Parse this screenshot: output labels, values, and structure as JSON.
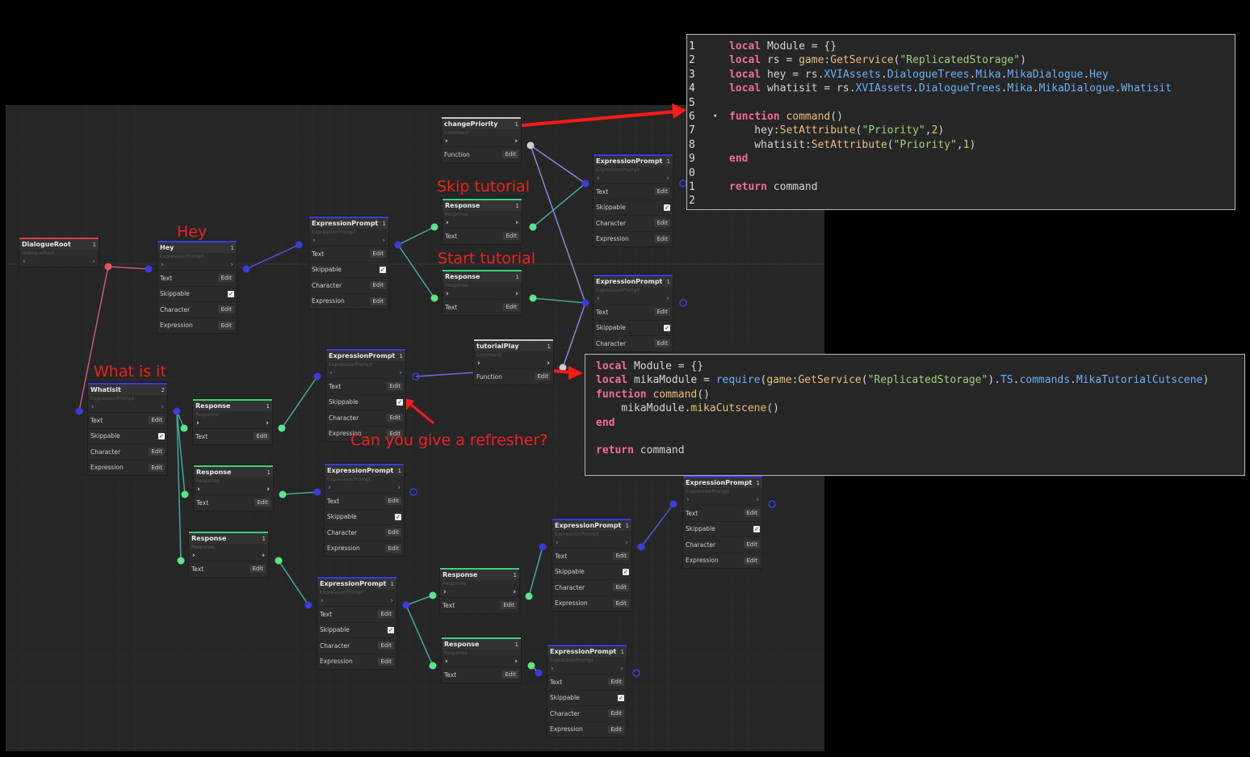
{
  "annotations": {
    "hey": "Hey",
    "what_is_it": "What is it",
    "skip_tutorial": "Skip tutorial",
    "start_tutorial": "Start tutorial",
    "refresher": "Can you give a refresher?"
  },
  "labels": {
    "edit": "Edit",
    "text": "Text",
    "skippable": "Skippable",
    "character": "Character",
    "expression": "Expression",
    "function": "Function",
    "expression_prompt": "ExpressionPrompt",
    "response": "Response",
    "command": "Command",
    "check": "✓",
    "count1": "1",
    "count2": "2"
  },
  "nodes": {
    "root": {
      "title": "DialogueRoot",
      "sub": "DialogueRoot",
      "count": "1"
    },
    "hey": {
      "title": "Hey",
      "sub": "ExpressionPrompt",
      "count": "1"
    },
    "whatisit": {
      "title": "Whatisit",
      "sub": "ExpressionPrompt",
      "count": "2"
    },
    "change_priority": {
      "title": "changePriority",
      "sub": "Command",
      "count": "1"
    },
    "tutorial_play": {
      "title": "tutorialPlay",
      "sub": "Command",
      "count": "1"
    }
  },
  "code1": {
    "lines": [
      {
        "n": "1",
        "parts": [
          [
            "kw",
            "local"
          ],
          [
            "ident",
            " Module = {}"
          ]
        ]
      },
      {
        "n": "2",
        "parts": [
          [
            "kw",
            "local"
          ],
          [
            "ident",
            " rs = "
          ],
          [
            "fn",
            "game"
          ],
          [
            "ident",
            ":"
          ],
          [
            "fn",
            "GetService"
          ],
          [
            "ident",
            "("
          ],
          [
            "str",
            "\"ReplicatedStorage\""
          ],
          [
            "ident",
            ")"
          ]
        ]
      },
      {
        "n": "3",
        "parts": [
          [
            "kw",
            "local"
          ],
          [
            "ident",
            " hey = rs."
          ],
          [
            "prop",
            "XVIAssets"
          ],
          [
            "ident",
            "."
          ],
          [
            "prop",
            "DialogueTrees"
          ],
          [
            "ident",
            "."
          ],
          [
            "prop",
            "Mika"
          ],
          [
            "ident",
            "."
          ],
          [
            "prop",
            "MikaDialogue"
          ],
          [
            "ident",
            "."
          ],
          [
            "prop",
            "Hey"
          ]
        ]
      },
      {
        "n": "4",
        "parts": [
          [
            "kw",
            "local"
          ],
          [
            "ident",
            " whatisit = rs."
          ],
          [
            "prop",
            "XVIAssets"
          ],
          [
            "ident",
            "."
          ],
          [
            "prop",
            "DialogueTrees"
          ],
          [
            "ident",
            "."
          ],
          [
            "prop",
            "Mika"
          ],
          [
            "ident",
            "."
          ],
          [
            "prop",
            "MikaDialogue"
          ],
          [
            "ident",
            "."
          ],
          [
            "prop",
            "Whatisit"
          ]
        ]
      },
      {
        "n": "5",
        "parts": []
      },
      {
        "n": "6",
        "parts": [
          [
            "kw",
            "function"
          ],
          [
            "ident",
            " "
          ],
          [
            "fn",
            "command"
          ],
          [
            "ident",
            "()"
          ]
        ],
        "fold": "▾"
      },
      {
        "n": "7",
        "parts": [
          [
            "ident",
            "    hey:"
          ],
          [
            "fn",
            "SetAttribute"
          ],
          [
            "ident",
            "("
          ],
          [
            "str",
            "\"Priority\""
          ],
          [
            "ident",
            ","
          ],
          [
            "num",
            "2"
          ],
          [
            "ident",
            ")"
          ]
        ]
      },
      {
        "n": "8",
        "parts": [
          [
            "ident",
            "    whatisit:"
          ],
          [
            "fn",
            "SetAttribute"
          ],
          [
            "ident",
            "("
          ],
          [
            "str",
            "\"Priority\""
          ],
          [
            "ident",
            ","
          ],
          [
            "num",
            "1"
          ],
          [
            "ident",
            ")"
          ]
        ]
      },
      {
        "n": "9",
        "parts": [
          [
            "kw",
            "end"
          ]
        ]
      },
      {
        "n": "0",
        "parts": []
      },
      {
        "n": "1",
        "parts": [
          [
            "kw",
            "return"
          ],
          [
            "ident",
            " command"
          ]
        ]
      },
      {
        "n": "2",
        "parts": []
      }
    ]
  },
  "code2": {
    "lines": [
      {
        "parts": [
          [
            "kw",
            "local"
          ],
          [
            "ident",
            " Module = {}"
          ]
        ]
      },
      {
        "parts": [
          [
            "kw",
            "local"
          ],
          [
            "ident",
            " mikaModule = "
          ],
          [
            "prop",
            "require"
          ],
          [
            "ident",
            "("
          ],
          [
            "fn",
            "game"
          ],
          [
            "ident",
            ":"
          ],
          [
            "fn",
            "GetService"
          ],
          [
            "ident",
            "("
          ],
          [
            "str",
            "\"ReplicatedStorage\""
          ],
          [
            "ident",
            ")."
          ],
          [
            "prop",
            "TS"
          ],
          [
            "ident",
            "."
          ],
          [
            "prop",
            "commands"
          ],
          [
            "ident",
            "."
          ],
          [
            "prop",
            "MikaTutorialCutscene"
          ],
          [
            "ident",
            ")"
          ]
        ]
      },
      {
        "parts": [
          [
            "kw",
            "function"
          ],
          [
            "ident",
            " "
          ],
          [
            "fn",
            "command"
          ],
          [
            "ident",
            "()"
          ]
        ]
      },
      {
        "parts": [
          [
            "ident",
            "    mikaModule."
          ],
          [
            "fn",
            "mikaCutscene"
          ],
          [
            "ident",
            "()"
          ]
        ]
      },
      {
        "parts": [
          [
            "kw",
            "end"
          ]
        ]
      },
      {
        "parts": []
      },
      {
        "parts": [
          [
            "kw",
            "return"
          ],
          [
            "ident",
            " command"
          ]
        ]
      }
    ]
  },
  "colors": {
    "prompt": "#3b3bd9",
    "response": "#39d27a",
    "root": "#d64747",
    "command": "#c9c9c9",
    "annotation": "#ef2020"
  }
}
